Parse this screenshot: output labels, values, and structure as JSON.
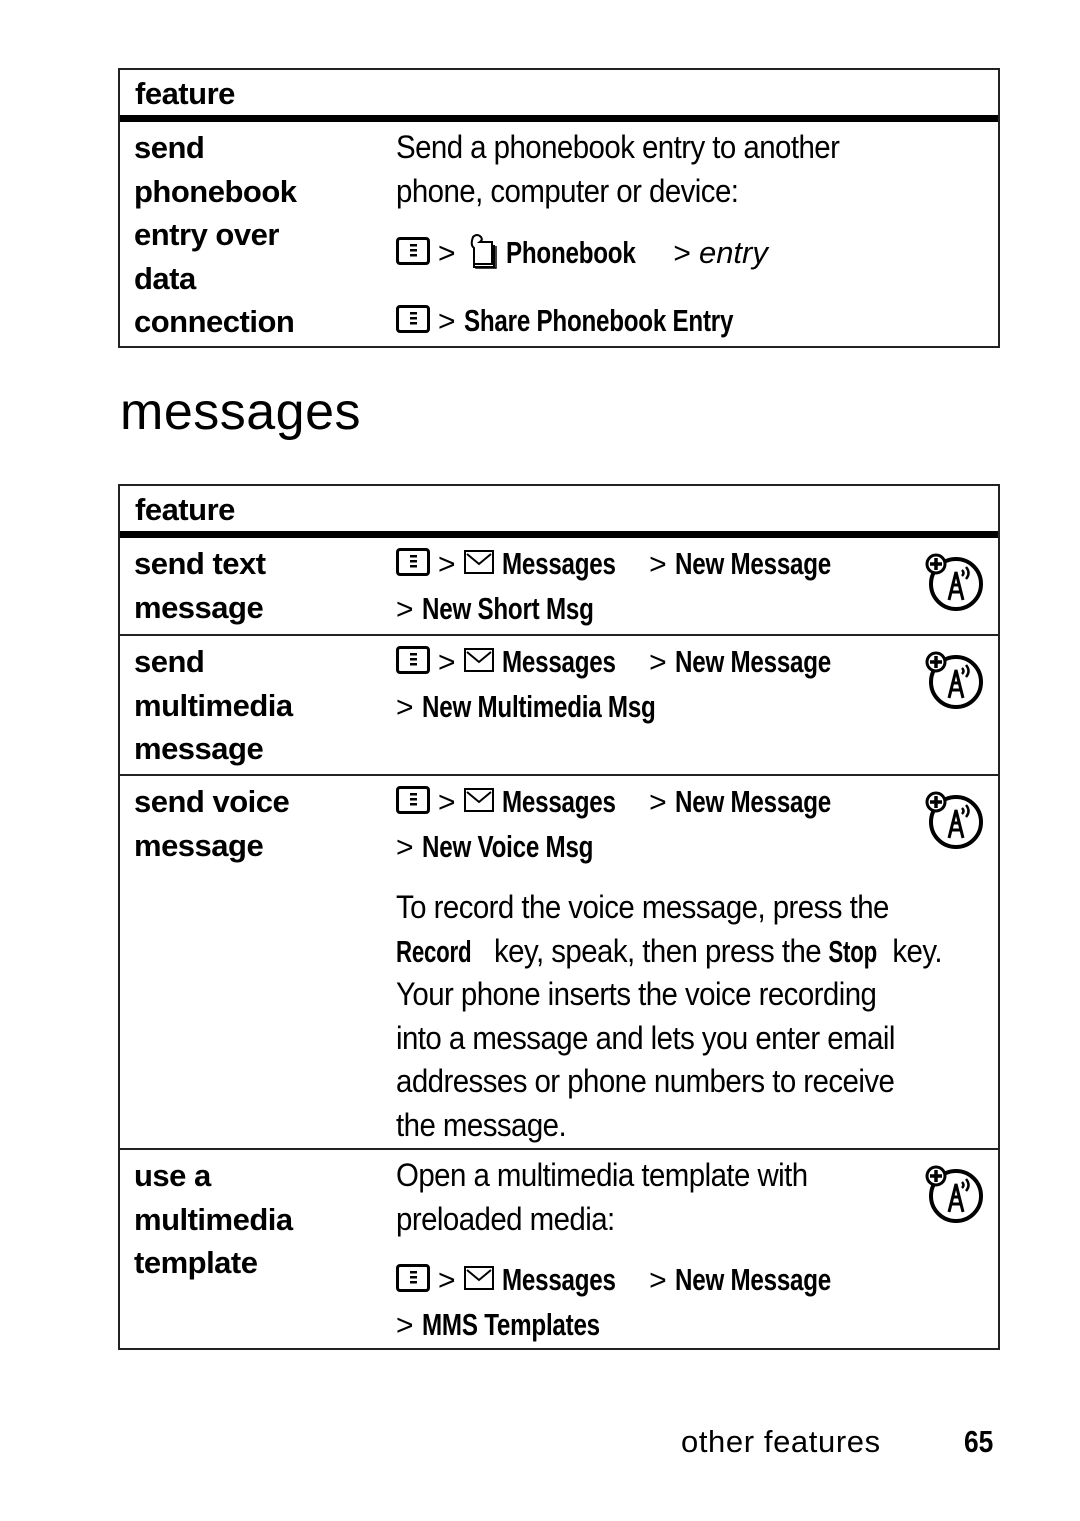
{
  "table1": {
    "header": "feature",
    "rows": [
      {
        "feature": [
          "send",
          "phonebook",
          "entry over",
          "data",
          "connection"
        ],
        "description": [
          "Send a phonebook entry to another",
          "phone, computer or device:"
        ],
        "path1": {
          "icon1": "menu-key-icon",
          "sep": ">",
          "icon2": "phonebook-icon",
          "item": "Phonebook",
          "sep2": ">",
          "item2": "entry"
        },
        "path2": {
          "icon1": "menu-key-icon",
          "sep": ">",
          "item": "Share Phonebook Entry"
        }
      }
    ]
  },
  "section_title": "messages",
  "table2": {
    "header": "feature",
    "rows": [
      {
        "feature": [
          "send text",
          "message"
        ],
        "path": {
          "menu": "Messages",
          "item1": "New Message",
          "item2": "New Short Msg"
        },
        "badge_icon": "network-dependent-feature-icon"
      },
      {
        "feature": [
          "send",
          "multimedia",
          "message"
        ],
        "path": {
          "menu": "Messages",
          "item1": "New Message",
          "item2": "New Multimedia Msg"
        },
        "badge_icon": "network-dependent-feature-icon"
      },
      {
        "feature": [
          "send voice",
          "message"
        ],
        "path": {
          "menu": "Messages",
          "item1": "New Message",
          "item2": "New Voice Msg"
        },
        "note": {
          "l1": "To record the voice message, press the",
          "record_key": "Record",
          "l2a": " key, speak, then press the ",
          "stop_key": "Stop",
          "l2b": " key.",
          "l3": "Your phone inserts the voice recording",
          "l4": "into a message and lets you enter email",
          "l5": "addresses or phone numbers to receive",
          "l6": "the message."
        },
        "badge_icon": "network-dependent-feature-icon"
      },
      {
        "feature": [
          "use a",
          "multimedia",
          "template"
        ],
        "description": [
          "Open a multimedia template with",
          "preloaded media:"
        ],
        "path": {
          "menu": "Messages",
          "item1": "New Message",
          "item2": "MMS Templates"
        },
        "badge_icon": "network-dependent-feature-icon"
      }
    ],
    "separator": ">"
  },
  "footer": {
    "section": "other features",
    "page_number": "65"
  }
}
